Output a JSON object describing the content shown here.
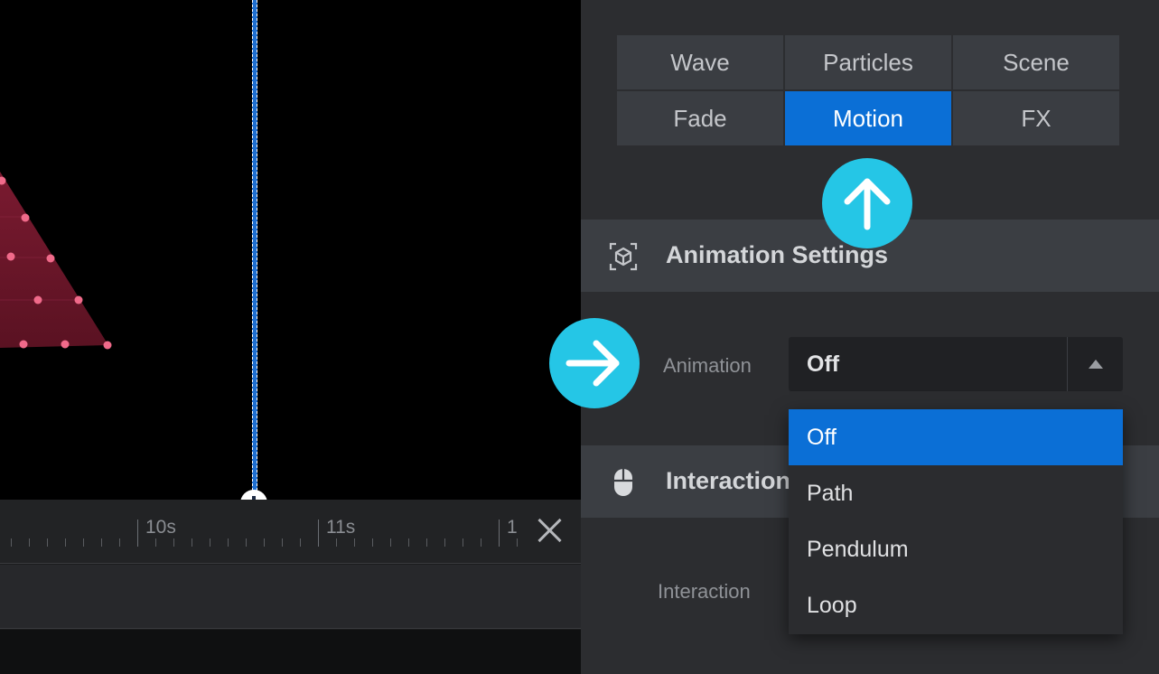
{
  "effect_tabs": [
    {
      "label": "Wave",
      "active": false
    },
    {
      "label": "Particles",
      "active": false
    },
    {
      "label": "Scene",
      "active": false
    },
    {
      "label": "Fade",
      "active": false
    },
    {
      "label": "Motion",
      "active": true
    },
    {
      "label": "FX",
      "active": false
    }
  ],
  "sections": {
    "animation_settings": {
      "title": "Animation Settings",
      "icon": "cube-icon"
    },
    "interaction": {
      "title": "Interaction",
      "icon": "mouse-icon"
    }
  },
  "animation_field": {
    "label": "Animation",
    "selected_value": "Off",
    "options": [
      "Off",
      "Path",
      "Pendulum",
      "Loop"
    ]
  },
  "interaction_field": {
    "label": "Interaction"
  },
  "timeline": {
    "tick_labels": [
      "10s",
      "11s",
      "1"
    ],
    "close_icon": "close-icon"
  },
  "callouts": [
    {
      "icon": "arrow-up-icon"
    },
    {
      "icon": "arrow-right-icon"
    }
  ],
  "colors": {
    "accent_blue": "#0b6fd6",
    "callout_cyan": "#25c6e6",
    "panel_bg": "#2c2d30",
    "triangle_fill": "#6b1628",
    "dot": "#f06a8a"
  }
}
